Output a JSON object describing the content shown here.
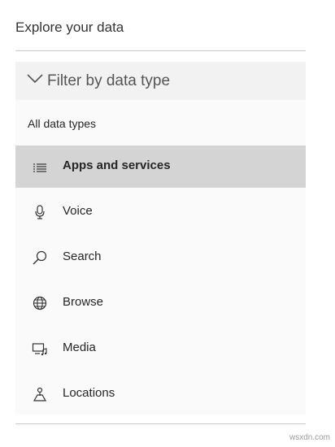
{
  "page": {
    "title": "Explore your data"
  },
  "filter": {
    "title": "Filter by data type",
    "all_label": "All data types",
    "items": [
      {
        "label": "Apps and services",
        "icon": "list-icon",
        "selected": true
      },
      {
        "label": "Voice",
        "icon": "microphone-icon",
        "selected": false
      },
      {
        "label": "Search",
        "icon": "search-icon",
        "selected": false
      },
      {
        "label": "Browse",
        "icon": "globe-icon",
        "selected": false
      },
      {
        "label": "Media",
        "icon": "media-icon",
        "selected": false
      },
      {
        "label": "Locations",
        "icon": "location-icon",
        "selected": false
      }
    ]
  },
  "watermark": "wsxdn.com",
  "colors": {
    "selected_bg": "#d4d4d4",
    "panel_bg": "#f2f2f2",
    "list_bg": "#fafafa"
  }
}
